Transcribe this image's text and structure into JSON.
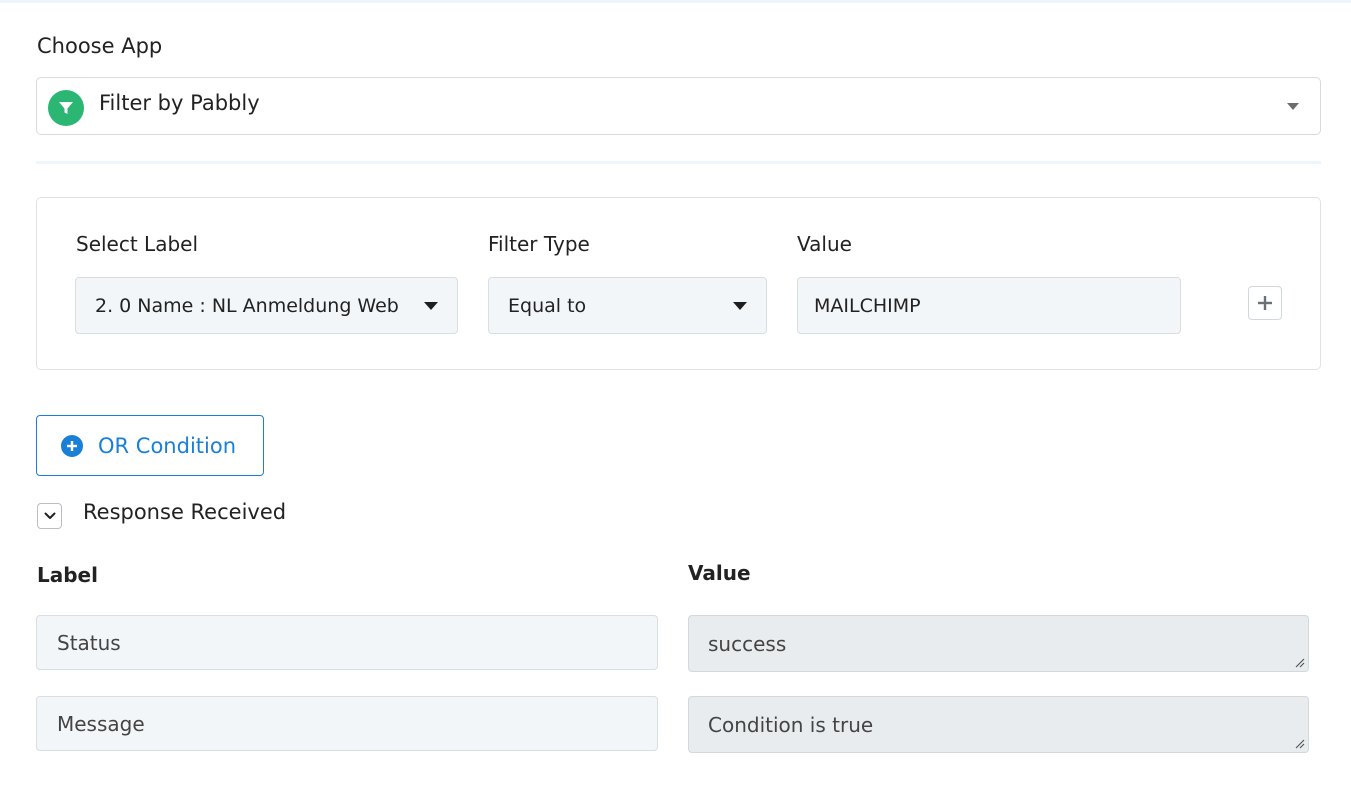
{
  "choose_app": {
    "label": "Choose App",
    "selected": "Filter by Pabbly",
    "icon": "funnel-icon",
    "icon_color": "#2bb673"
  },
  "filter": {
    "select_label": {
      "label": "Select Label",
      "value": "2. 0 Name : NL Anmeldung Web"
    },
    "filter_type": {
      "label": "Filter Type",
      "value": "Equal to"
    },
    "value": {
      "label": "Value",
      "value": "MAILCHIMP"
    },
    "add_icon": "plus-icon"
  },
  "or_condition": {
    "label": "OR Condition",
    "icon": "plus-circle-icon",
    "color": "#1a7fd6"
  },
  "response": {
    "title": "Response Received",
    "toggle_icon": "chevron-down-icon",
    "label_header": "Label",
    "value_header": "Value",
    "rows": [
      {
        "label": "Status",
        "value": "success"
      },
      {
        "label": "Message",
        "value": "Condition is true"
      }
    ]
  }
}
